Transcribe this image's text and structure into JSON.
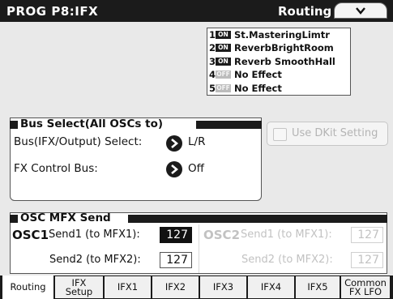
{
  "title": {
    "left": "PROG P8:IFX",
    "right": "Routing"
  },
  "menu": {
    "icon": "chevron-down-icon"
  },
  "ifx_slots": [
    {
      "num": "1",
      "state": "ON",
      "name": "St.MasteringLimtr"
    },
    {
      "num": "2",
      "state": "ON",
      "name": "ReverbBrightRoom"
    },
    {
      "num": "3",
      "state": "ON",
      "name": "Reverb SmoothHall"
    },
    {
      "num": "4",
      "state": "OFF",
      "name": "No Effect"
    },
    {
      "num": "5",
      "state": "OFF",
      "name": "No Effect"
    }
  ],
  "bus_select": {
    "heading": "Bus Select(All OSCs to)",
    "bus_label": "Bus(IFX/Output) Select:",
    "bus_value": "L/R",
    "fx_label": "FX Control Bus:",
    "fx_value": "Off"
  },
  "dkit": {
    "label": "Use DKit Setting",
    "checked": false,
    "enabled": false
  },
  "osc_send": {
    "heading": "OSC MFX Send",
    "osc1": {
      "title": "OSC1",
      "send1_label": "Send1 (to MFX1):",
      "send1_value": "127",
      "send2_label": "Send2 (to MFX2):",
      "send2_value": "127"
    },
    "osc2": {
      "title": "OSC2",
      "send1_label": "Send1 (to MFX1):",
      "send1_value": "127",
      "send2_label": "Send2 (to MFX2):",
      "send2_value": "127"
    }
  },
  "tabs": [
    "Routing",
    "IFX\nSetup",
    "IFX1",
    "IFX2",
    "IFX3",
    "IFX4",
    "IFX5",
    "Common\nFX LFO"
  ],
  "active_tab": "Routing",
  "colors": {
    "background": "#e9e9e9",
    "bar": "#1b1b1b",
    "disabled": "#c2c2c2"
  }
}
